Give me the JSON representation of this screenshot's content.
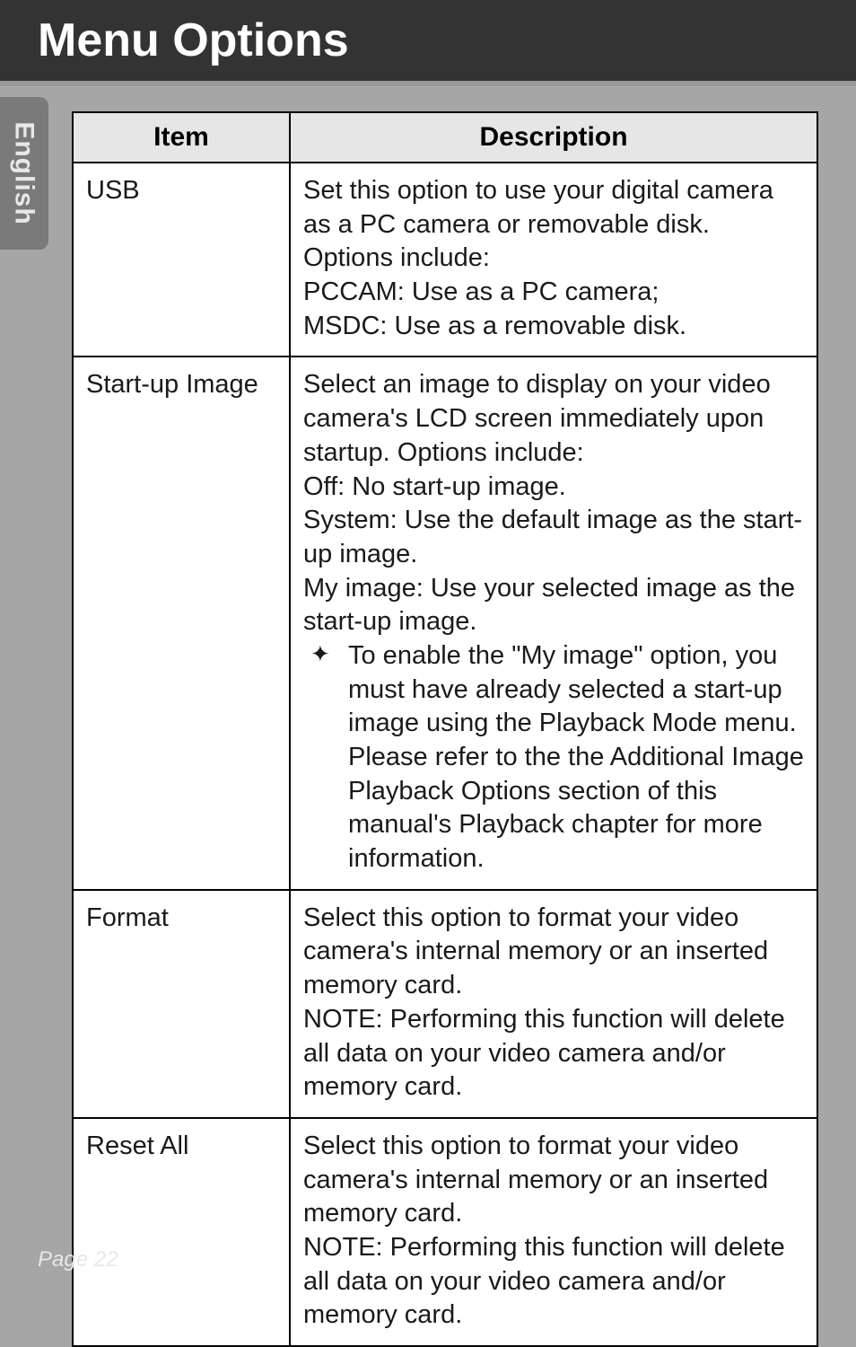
{
  "header": {
    "title": "Menu Options"
  },
  "side_tab": {
    "label": "English"
  },
  "table": {
    "headers": {
      "item": "Item",
      "description": "Description"
    },
    "rows": [
      {
        "item": "USB",
        "description_lines": [
          "Set this option to use your digital camera as a PC camera or removable disk.  Options include:",
          "PCCAM: Use as a PC camera;",
          "MSDC: Use as a removable disk."
        ]
      },
      {
        "item": "Start-up Image",
        "description_lines": [
          "Select an image to display on your video camera's LCD screen immediately upon startup. Options include:",
          "Off: No start-up image.",
          "System: Use the default image as the start-up image.",
          "My image: Use your selected image as the start-up image."
        ],
        "sublist": [
          "To enable the \"My image\" option, you must have already selected a start-up image using the Playback Mode menu. Please refer to the the Additional Image Playback Options section of this manual's Playback chapter for more information."
        ]
      },
      {
        "item": "Format",
        "description_lines": [
          "Select this option to format your video camera's internal memory or an inserted memory card.",
          "NOTE: Performing this function will delete all data on your video camera and/or memory card."
        ]
      },
      {
        "item": "Reset All",
        "description_lines": [
          "Select this option to format your video camera's internal memory or an inserted memory card.",
          "NOTE: Performing this function will delete all data on your video camera and/or memory card."
        ]
      }
    ]
  },
  "footer": {
    "page_label": "Page 22"
  },
  "icons": {
    "star": "✦"
  }
}
